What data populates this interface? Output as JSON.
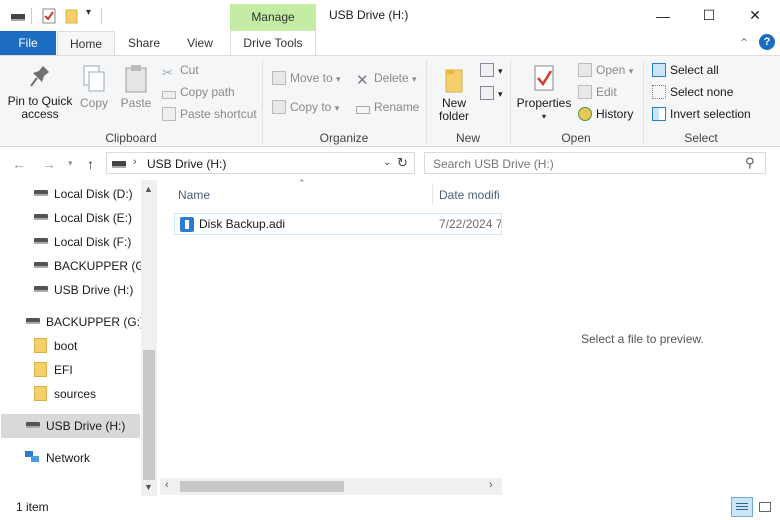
{
  "window": {
    "title": "USB Drive (H:)",
    "minimize_glyph": "—",
    "maximize_glyph": "☐",
    "close_glyph": "✕"
  },
  "ribbon_tabs": {
    "file": "File",
    "home": "Home",
    "share": "Share",
    "view": "View",
    "contextual_group": "Manage",
    "drive_tools": "Drive Tools"
  },
  "ribbon": {
    "clipboard": {
      "label": "Clipboard",
      "pin": "Pin to Quick access",
      "copy": "Copy",
      "paste": "Paste",
      "cut": "Cut",
      "copy_path": "Copy path",
      "paste_shortcut": "Paste shortcut"
    },
    "organize": {
      "label": "Organize",
      "move_to": "Move to",
      "copy_to": "Copy to",
      "delete": "Delete",
      "rename": "Rename"
    },
    "new": {
      "label": "New",
      "new_folder": "New folder"
    },
    "open": {
      "label": "Open",
      "properties": "Properties",
      "open": "Open",
      "edit": "Edit",
      "history": "History"
    },
    "select": {
      "label": "Select",
      "select_all": "Select all",
      "select_none": "Select none",
      "invert_selection": "Invert selection"
    }
  },
  "address_bar": {
    "path": "USB Drive (H:)",
    "search_placeholder": "Search USB Drive (H:)"
  },
  "nav_pane": {
    "items": [
      {
        "label": "Local Disk (D:)",
        "icon": "drive-icon"
      },
      {
        "label": "Local Disk (E:)",
        "icon": "drive-icon"
      },
      {
        "label": "Local Disk (F:)",
        "icon": "drive-icon"
      },
      {
        "label": "BACKUPPER (G:)",
        "icon": "drive-icon"
      },
      {
        "label": "USB Drive (H:)",
        "icon": "drive-icon"
      },
      {
        "label": "BACKUPPER (G:)",
        "icon": "drive-icon"
      },
      {
        "label": "boot",
        "icon": "folder-icon"
      },
      {
        "label": "EFI",
        "icon": "folder-icon"
      },
      {
        "label": "sources",
        "icon": "folder-icon"
      },
      {
        "label": "USB Drive (H:)",
        "icon": "drive-icon"
      },
      {
        "label": "Network",
        "icon": "network-icon"
      }
    ]
  },
  "file_list": {
    "columns": [
      "Name",
      "Date modifi"
    ],
    "rows": [
      {
        "name": "Disk Backup.adi",
        "date": "7/22/2024 7:"
      }
    ]
  },
  "preview": {
    "message": "Select a file to preview."
  },
  "status_bar": {
    "item_count": "1 item"
  },
  "colors": {
    "file_tab": "#1c6cc1",
    "manage_tab": "#c4eca4",
    "ribbon_bg": "#f5f6f7",
    "selection": "#cce8ff"
  }
}
